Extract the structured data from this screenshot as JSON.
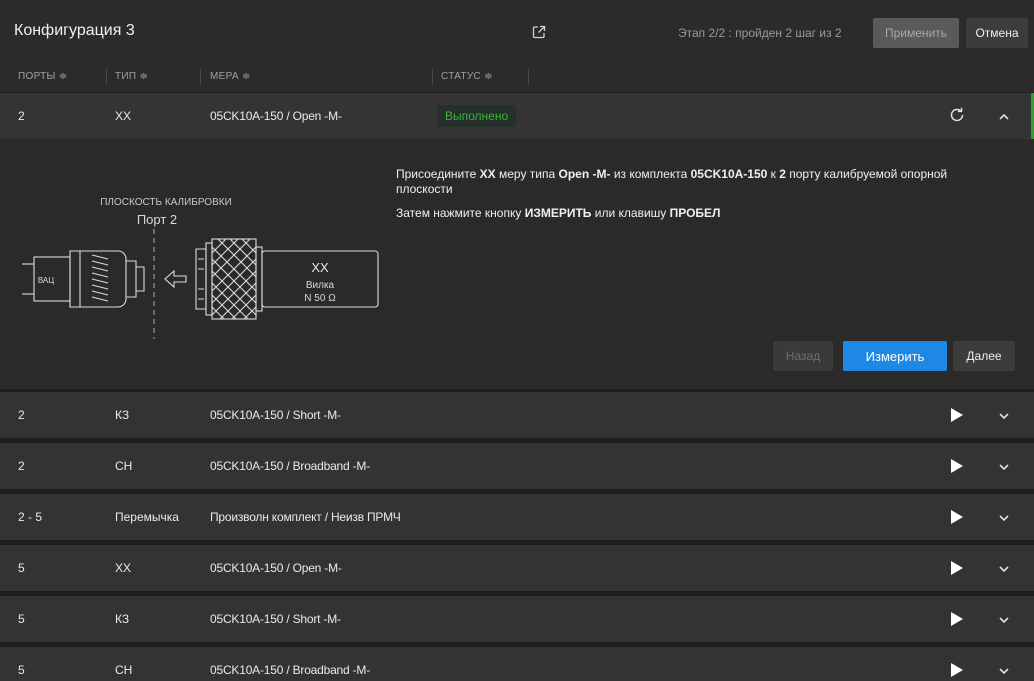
{
  "header": {
    "title": "Конфигурация 3",
    "step_text": "Этап 2/2 : пройден 2 шаг из 2",
    "apply_label": "Применить",
    "cancel_label": "Отмена"
  },
  "columns": [
    "ПОРТЫ ≑",
    "ТИП ≑",
    "МЕРА ≑",
    "СТАТУС ≑"
  ],
  "expanded_row": {
    "port": "2",
    "type": "XX",
    "standard": "05CK10A-150 / Open -M-",
    "status": "Выполнено"
  },
  "panel": {
    "diagram": {
      "plane_label": "ПЛОСКОСТЬ КАЛИБРОВКИ",
      "port_label": "Порт 2",
      "vna_label": "ВАЦ",
      "std_name": "XX",
      "std_sex": "Вилка",
      "std_impedance": "N 50 Ω"
    },
    "instr1": {
      "p1": "Присоедините ",
      "b1": "XX",
      "p2": " меру типа ",
      "b2": "Open -M-",
      "p3": " из комплекта ",
      "b3": "05CK10A-150",
      "p4": " к ",
      "b4": "2",
      "p5": " порту калибруемой опорной плоскости"
    },
    "instr2": {
      "p1": "Затем нажмите кнопку ",
      "b1": "ИЗМЕРИТЬ",
      "p2": " или клавишу ",
      "b2": "ПРОБЕЛ"
    },
    "back_label": "Назад",
    "measure_label": "Измерить",
    "next_label": "Далее"
  },
  "rows": [
    {
      "port": "2",
      "type": "КЗ",
      "standard": "05CK10A-150 / Short -M-"
    },
    {
      "port": "2",
      "type": "СН",
      "standard": "05CK10A-150 / Broadband -M-"
    },
    {
      "port": "2 - 5",
      "type": "Перемычка",
      "standard": "Произволн комплект / Неизв ПРМЧ"
    },
    {
      "port": "5",
      "type": "XX",
      "standard": "05CK10A-150 / Open -M-"
    },
    {
      "port": "5",
      "type": "КЗ",
      "standard": "05CK10A-150 / Short -M-"
    },
    {
      "port": "5",
      "type": "СН",
      "standard": "05CK10A-150 / Broadband -M-"
    }
  ],
  "icons": {
    "export": "external-link-icon",
    "refresh": "refresh-icon",
    "collapse": "chevron-up-icon",
    "play": "play-icon",
    "expand": "chevron-down-icon"
  },
  "colors": {
    "accent": "#1e88e5",
    "status_ok": "#3db23d",
    "background": "#1e1e1e",
    "row_bg": "#333333"
  }
}
